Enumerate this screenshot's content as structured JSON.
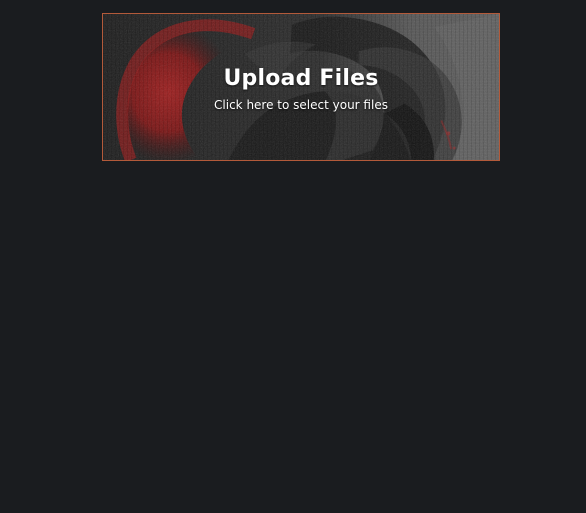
{
  "upload": {
    "title": "Upload Files",
    "subtitle": "Click here to select your files"
  },
  "colors": {
    "page_background": "#1a1c1f",
    "upload_border": "#b35a3a",
    "text": "#ffffff",
    "background_red": "#7a1616"
  }
}
